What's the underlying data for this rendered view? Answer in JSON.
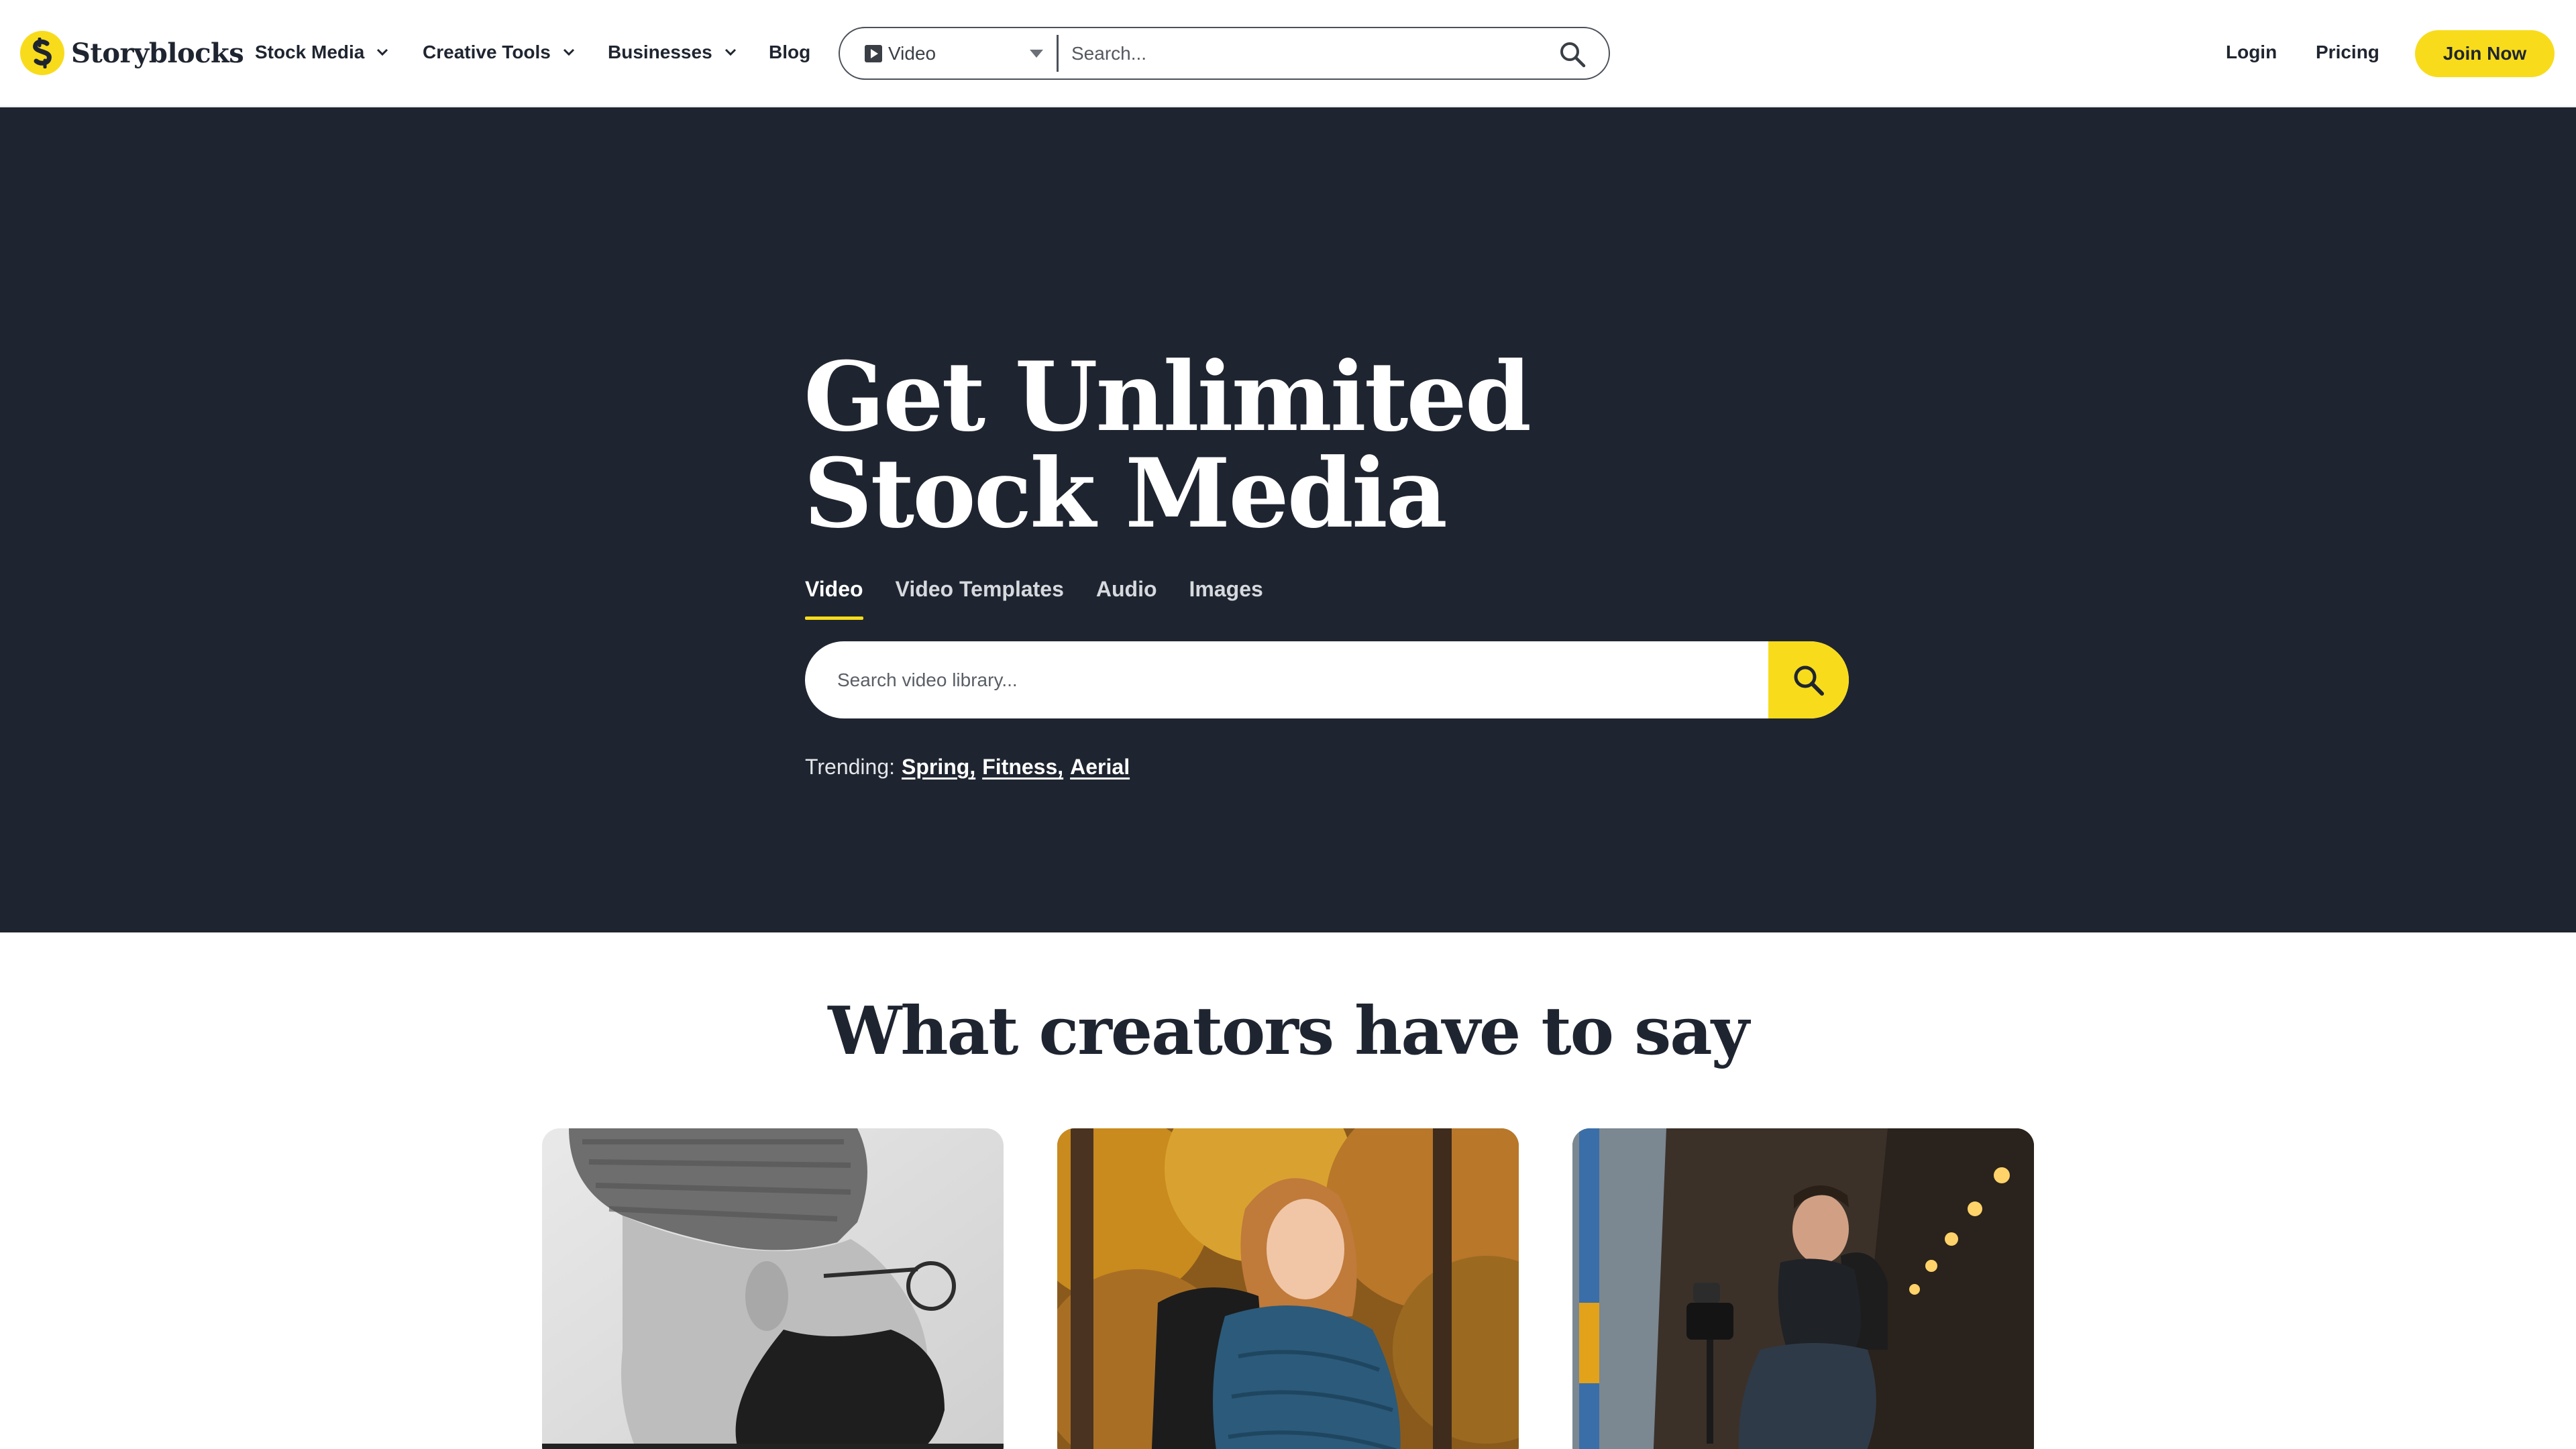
{
  "brand": {
    "name": "Storyblocks",
    "accent": "#f8dc1b",
    "dark": "#1f2530"
  },
  "nav": {
    "items": [
      {
        "label": "Stock Media",
        "has_dropdown": true
      },
      {
        "label": "Creative Tools",
        "has_dropdown": true
      },
      {
        "label": "Businesses",
        "has_dropdown": true
      },
      {
        "label": "Blog",
        "has_dropdown": false
      }
    ],
    "search": {
      "type_selected": "Video",
      "type_icon": "play-icon",
      "placeholder": "Search..."
    },
    "login_label": "Login",
    "pricing_label": "Pricing",
    "join_label": "Join Now"
  },
  "hero": {
    "title_line1": "Get Unlimited",
    "title_line2": "Stock Media",
    "tabs": [
      {
        "label": "Video",
        "active": true
      },
      {
        "label": "Video Templates",
        "active": false
      },
      {
        "label": "Audio",
        "active": false
      },
      {
        "label": "Images",
        "active": false
      }
    ],
    "search_placeholder": "Search video library...",
    "trending_label": "Trending:",
    "trending_items": [
      "Spring,",
      "Fitness,",
      "Aerial"
    ]
  },
  "testimonials": {
    "title": "What creators have to say",
    "cards": [
      {
        "image": "creator-portrait-bw"
      },
      {
        "image": "creator-hiker-autumn"
      },
      {
        "image": "creator-filmmaker-tunnel"
      }
    ]
  }
}
